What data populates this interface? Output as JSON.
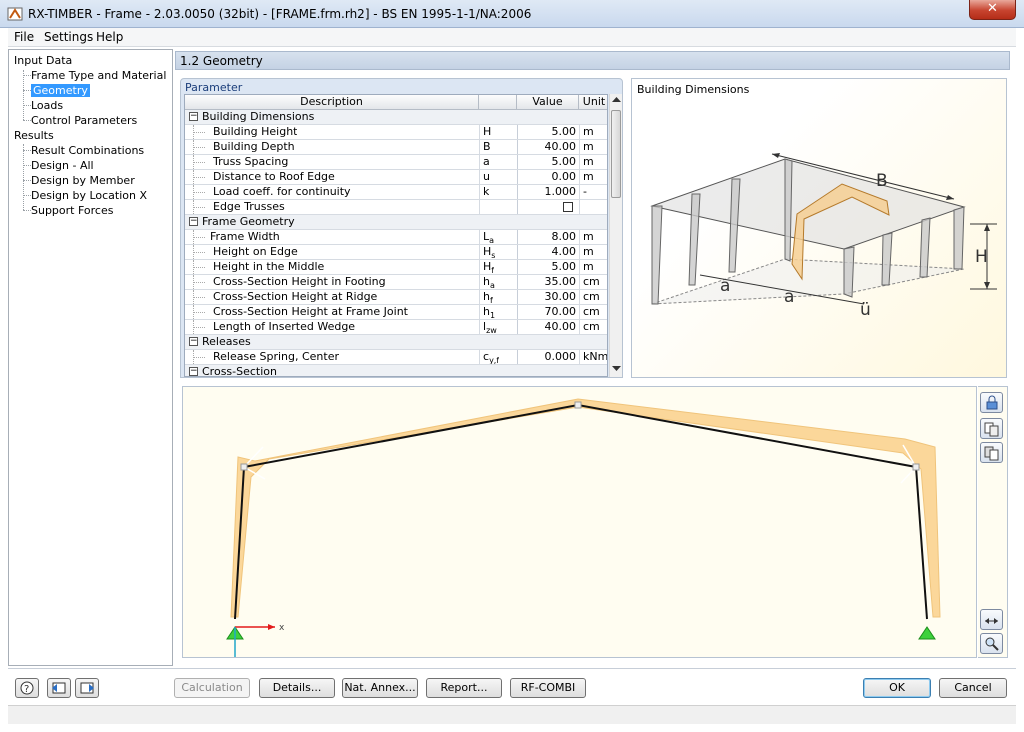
{
  "window": {
    "title": "RX-TIMBER - Frame - 2.03.0050 (32bit) - [FRAME.frm.rh2] - BS EN 1995-1-1/NA:2006",
    "close_label": "✕"
  },
  "menu": [
    "File",
    "Settings",
    "Help"
  ],
  "nav": {
    "input_header": "Input Data",
    "input_items": [
      "Frame Type and Material",
      "Geometry",
      "Loads",
      "Control Parameters"
    ],
    "results_header": "Results",
    "result_items": [
      "Result Combinations",
      "Design - All",
      "Design by Member",
      "Design by Location X",
      "Support Forces"
    ]
  },
  "section_title": "1.2 Geometry",
  "param": {
    "label": "Parameter",
    "headers": {
      "description": "Description",
      "value": "Value",
      "unit": "Unit"
    },
    "groups": [
      {
        "title": "Building Dimensions",
        "rows": [
          {
            "desc": "Building Height",
            "sym": "H",
            "sub": "",
            "val": "5.00",
            "unit": "m"
          },
          {
            "desc": "Building Depth",
            "sym": "B",
            "sub": "",
            "val": "40.00",
            "unit": "m"
          },
          {
            "desc": "Truss Spacing",
            "sym": "a",
            "sub": "",
            "val": "5.00",
            "unit": "m"
          },
          {
            "desc": "Distance to Roof Edge",
            "sym": "u",
            "sub": "",
            "val": "0.00",
            "unit": "m"
          },
          {
            "desc": "Load coeff. for continuity",
            "sym": "k",
            "sub": "",
            "val": "1.000",
            "unit": "-"
          },
          {
            "desc": "Edge Trusses",
            "sym": "",
            "sub": "",
            "val": "",
            "unit": "",
            "checkbox": true
          }
        ]
      },
      {
        "title": "Frame Geometry",
        "rows": [
          {
            "desc": "Frame Width",
            "sym": "L",
            "sub": "a",
            "val": "8.00",
            "unit": "m",
            "shallow": true
          },
          {
            "desc": "Height on Edge",
            "sym": "H",
            "sub": "s",
            "val": "4.00",
            "unit": "m"
          },
          {
            "desc": "Height in the Middle",
            "sym": "H",
            "sub": "f",
            "val": "5.00",
            "unit": "m"
          },
          {
            "desc": "Cross-Section Height in Footing",
            "sym": "h",
            "sub": "a",
            "val": "35.00",
            "unit": "cm"
          },
          {
            "desc": "Cross-Section Height at Ridge",
            "sym": "h",
            "sub": "f",
            "val": "30.00",
            "unit": "cm"
          },
          {
            "desc": "Cross-Section Height at Frame Joint",
            "sym": "h",
            "sub": "1",
            "val": "70.00",
            "unit": "cm"
          },
          {
            "desc": "Length of Inserted Wedge",
            "sym": "l",
            "sub": "zw",
            "val": "40.00",
            "unit": "cm"
          }
        ]
      },
      {
        "title": "Releases",
        "rows": [
          {
            "desc": "Release Spring, Center",
            "sym": "c",
            "sub": "y,f",
            "val": "0.000",
            "unit": "kNm/"
          }
        ]
      },
      {
        "title": "Cross-Section",
        "rows": []
      }
    ]
  },
  "image_panel": {
    "title": "Building Dimensions",
    "labels": {
      "B": "B",
      "H": "H",
      "a1": "a",
      "a2": "a",
      "u": "ü"
    }
  },
  "frame_view": {
    "axis_label": "x"
  },
  "buttons": {
    "calculation": "Calculation",
    "details": "Details...",
    "nat_annex": "Nat. Annex...",
    "report": "Report...",
    "rf_combi": "RF-COMBI",
    "ok": "OK",
    "cancel": "Cancel"
  },
  "colors": {
    "timber": "#fbd79a",
    "selection": "#3399ff",
    "support": "#3dd13d"
  }
}
